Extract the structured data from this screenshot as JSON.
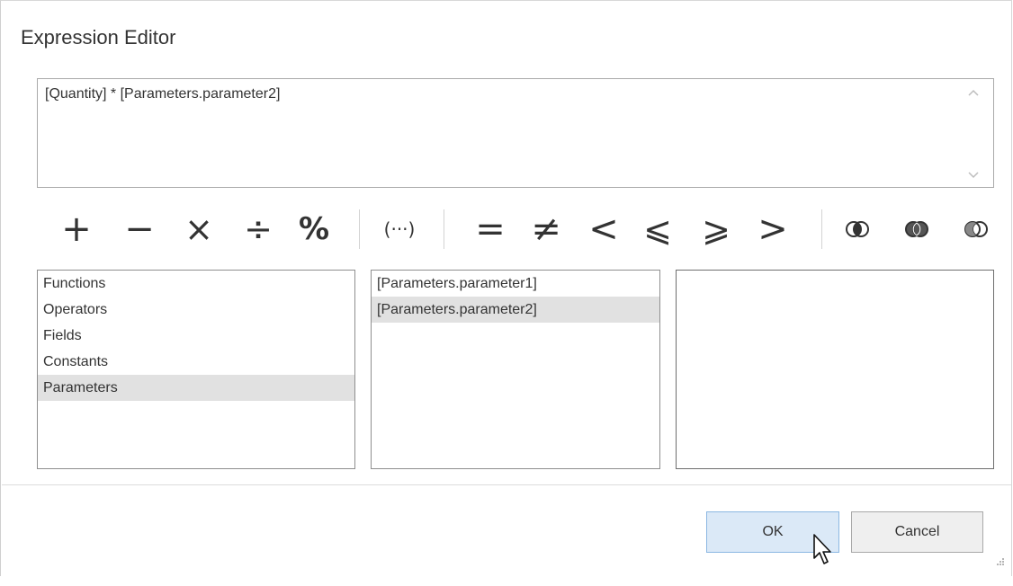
{
  "dialog": {
    "title": "Expression Editor"
  },
  "expression": {
    "text": "[Quantity] * [Parameters.parameter2]"
  },
  "toolbar": {
    "operators": {
      "plus": "+",
      "minus": "−",
      "multiply": "×",
      "divide": "÷",
      "modulo": "%",
      "parentheses": "(···)",
      "equal": "=",
      "not_equal": "≠",
      "less": "<",
      "less_equal": "⩽",
      "greater_equal": "⩾",
      "greater": ">"
    },
    "logic_icons": [
      "logic-and-icon",
      "logic-or-icon",
      "logic-not-icon"
    ]
  },
  "categories": {
    "items": [
      {
        "label": "Functions"
      },
      {
        "label": "Operators"
      },
      {
        "label": "Fields"
      },
      {
        "label": "Constants"
      },
      {
        "label": "Parameters"
      }
    ],
    "selected": "Parameters"
  },
  "parameters": {
    "items": [
      {
        "label": "[Parameters.parameter1]"
      },
      {
        "label": "[Parameters.parameter2]"
      }
    ],
    "selected": "[Parameters.parameter2]"
  },
  "description": {
    "text": ""
  },
  "buttons": {
    "ok": "OK",
    "cancel": "Cancel"
  },
  "colors": {
    "selection": "#e1e1e1",
    "ok_button_bg": "#dbe9f7",
    "ok_button_border": "#8cb8e2"
  }
}
